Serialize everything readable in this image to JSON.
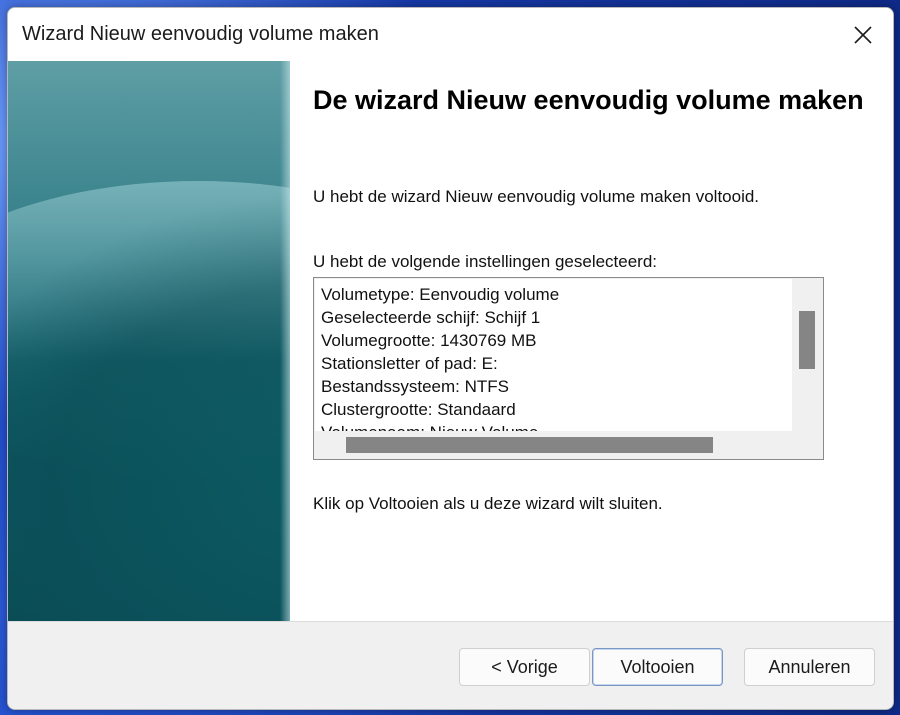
{
  "window": {
    "title": "Wizard Nieuw eenvoudig volume maken",
    "close_icon": "close-icon"
  },
  "main": {
    "heading": "De wizard Nieuw eenvoudig volume maken",
    "intro": "U hebt de wizard Nieuw eenvoudig volume maken voltooid.",
    "list_label": "U hebt de volgende instellingen geselecteerd:",
    "settings": [
      "Volumetype: Eenvoudig volume",
      "Geselecteerde schijf: Schijf 1",
      "Volumegrootte: 1430769 MB",
      "Stationsletter of pad: E:",
      "Bestandssysteem: NTFS",
      "Clustergrootte: Standaard",
      "Volumenaam: Nieuw Volume"
    ],
    "finish_instruction": "Klik op Voltooien als u deze wizard wilt sluiten."
  },
  "footer": {
    "back_label": "< Vorige",
    "finish_label": "Voltooien",
    "cancel_label": "Annuleren"
  },
  "colors": {
    "side_panel": "#0b5059",
    "accent_border": "#7a96c4"
  }
}
